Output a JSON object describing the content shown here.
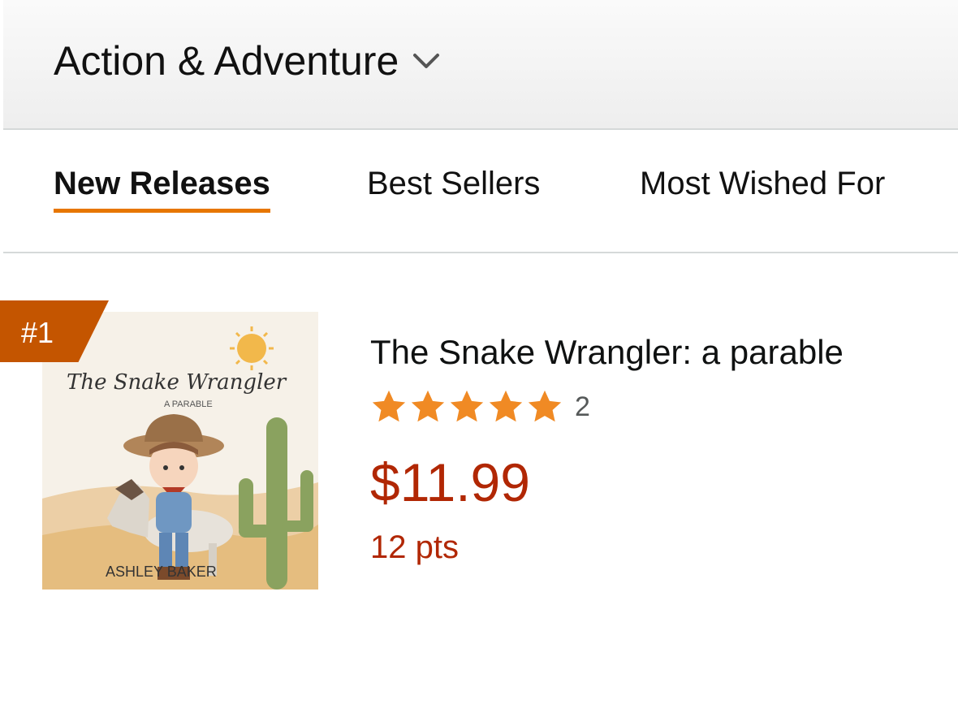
{
  "header": {
    "category_title": "Action & Adventure",
    "chevron_icon": "chevron-down-icon"
  },
  "tabs": [
    {
      "label": "New Releases",
      "active": true
    },
    {
      "label": "Best Sellers",
      "active": false
    },
    {
      "label": "Most Wished For",
      "active": false
    }
  ],
  "product": {
    "rank": "#1",
    "title": "The Snake Wrangler: a parable",
    "rating_stars": 5,
    "review_count": "2",
    "price": "$11.99",
    "points": "12 pts",
    "cover": {
      "title": "The Snake Wrangler",
      "subtitle": "A PARABLE",
      "author": "ASHLEY BAKER"
    }
  },
  "colors": {
    "accent": "#e77600",
    "badge": "#c45500",
    "price": "#b12704",
    "star": "#f08a24"
  }
}
